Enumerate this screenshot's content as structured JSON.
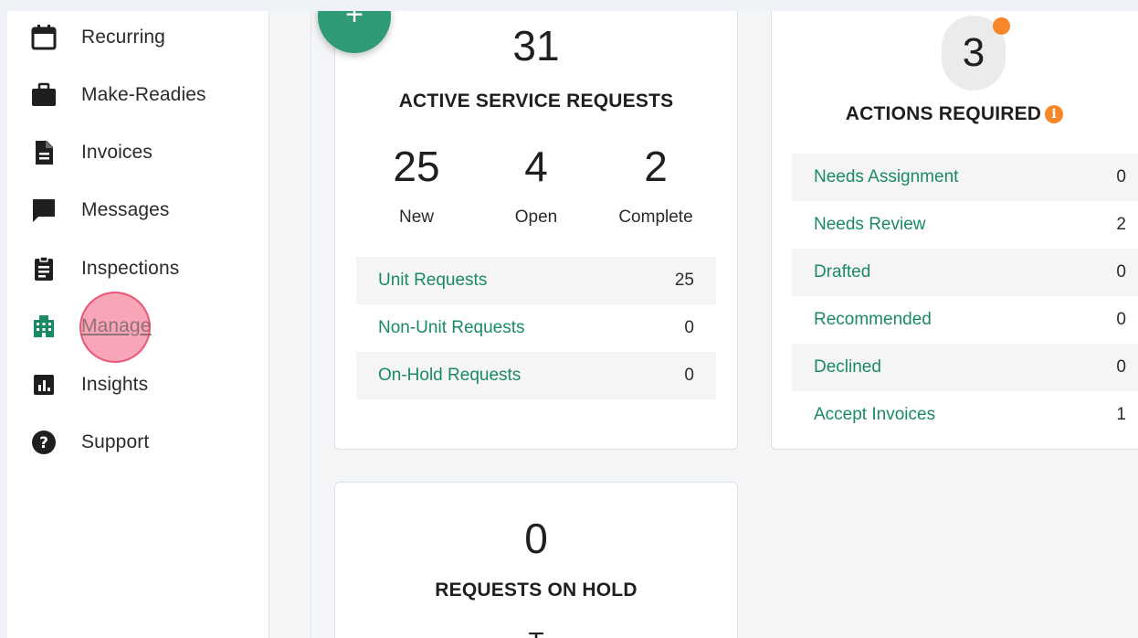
{
  "sidebar": {
    "items": [
      {
        "label": "Recurring",
        "icon": "calendar-icon"
      },
      {
        "label": "Make-Readies",
        "icon": "briefcase-icon"
      },
      {
        "label": "Invoices",
        "icon": "document-icon"
      },
      {
        "label": "Messages",
        "icon": "chat-bubble-icon"
      },
      {
        "label": "Inspections",
        "icon": "clipboard-icon"
      },
      {
        "label": "Manage",
        "icon": "building-icon"
      },
      {
        "label": "Insights",
        "icon": "bar-chart-icon"
      },
      {
        "label": "Support",
        "icon": "help-circle-icon"
      }
    ]
  },
  "fab": {
    "label": "+"
  },
  "active_requests": {
    "total": "31",
    "title": "ACTIVE SERVICE REQUESTS",
    "stats": [
      {
        "value": "25",
        "label": "New"
      },
      {
        "value": "4",
        "label": "Open"
      },
      {
        "value": "2",
        "label": "Complete"
      }
    ],
    "rows": [
      {
        "label": "Unit Requests",
        "count": "25"
      },
      {
        "label": "Non-Unit Requests",
        "count": "0"
      },
      {
        "label": "On-Hold Requests",
        "count": "0"
      }
    ]
  },
  "actions_required": {
    "total": "3",
    "title": "ACTIONS REQUIRED",
    "info_glyph": "i",
    "rows": [
      {
        "label": "Needs Assignment",
        "count": "0"
      },
      {
        "label": "Needs Review",
        "count": "2"
      },
      {
        "label": "Drafted",
        "count": "0"
      },
      {
        "label": "Recommended",
        "count": "0"
      },
      {
        "label": "Declined",
        "count": "0"
      },
      {
        "label": "Accept Invoices",
        "count": "1"
      }
    ]
  },
  "on_hold": {
    "total": "0",
    "title": "REQUESTS ON HOLD",
    "cut_off_text": "T"
  },
  "colors": {
    "accent": "#1a8a66",
    "fab": "#2e9a76",
    "badge": "#f5862a",
    "click_indicator": "#f35d7c"
  }
}
